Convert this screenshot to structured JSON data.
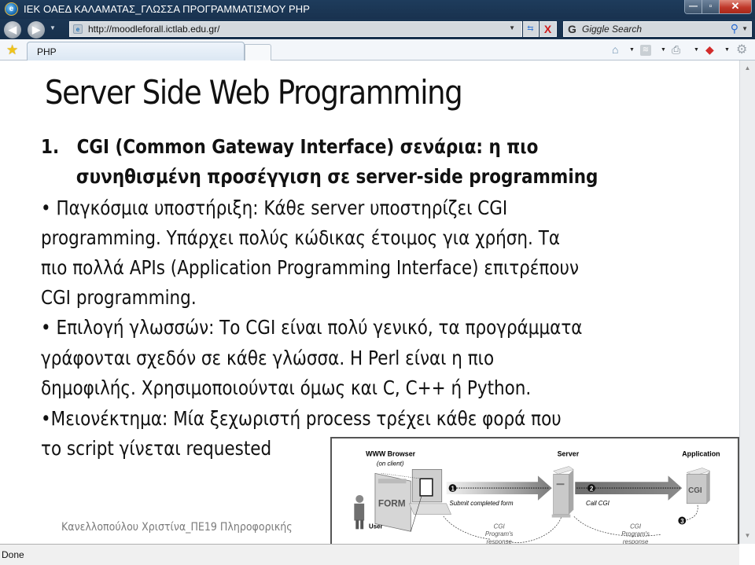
{
  "window": {
    "title": "ΙΕΚ ΟΑΕΔ ΚΑΛΑΜΑΤΑΣ_ΓΛΩΣΣΑ ΠΡΟΓΡΑΜΜΑΤΙΣΜΟΥ PHP",
    "app_icon": "ie-logo-icon",
    "buttons": {
      "minimize": "—",
      "maximize": "▫",
      "close": "✕"
    }
  },
  "nav": {
    "back_icon": "◀",
    "forward_icon": "▶",
    "history_dropdown": "▼",
    "address": "http://moodleforall.ictlab.edu.gr/",
    "address_dropdown": "▼",
    "refresh_icon": "⇆",
    "stop_icon": "X",
    "search_placeholder": "Giggle Search",
    "search_engine_icon": "G",
    "search_icon": "⚲",
    "search_dropdown": "▼"
  },
  "tabs": {
    "favorites_icon": "★",
    "items": [
      {
        "label": "PHP",
        "active": true
      }
    ]
  },
  "command_bar": {
    "home_icon": "⌂",
    "feeds_icon": "≋",
    "print_icon": "⎙",
    "safety_icon": "◆",
    "tools_icon": "⚙",
    "dropdown": "▼"
  },
  "slide": {
    "title": "Server Side Web Programming",
    "lines": [
      {
        "text": "1.   CGI (Common Gateway Interface) σενάρια: η πιο",
        "bold": true
      },
      {
        "text": "      συνηθισμένη προσέγγιση σε server-side programming",
        "bold": true
      },
      {
        "text": "• Παγκόσμια υποστήριξη: Κάθε server υποστηρίζει CGI",
        "bold": false
      },
      {
        "text": "programming. Υπάρχει πολύς κώδικας έτοιμος για χρήση. Τα",
        "bold": false
      },
      {
        "text": "πιο πολλά APIs (Application Programming Interface) επιτρέπουν",
        "bold": false
      },
      {
        "text": "CGI programming.",
        "bold": false
      },
      {
        "text": "• Επιλογή γλωσσών: Το CGI είναι πολύ γενικό, τα προγράμματα",
        "bold": false
      },
      {
        "text": "γράφονται σχεδόν σε κάθε γλώσσα. Η Perl είναι η πιο",
        "bold": false
      },
      {
        "text": "δημοφιλής. Χρησιμοποιούνται όμως και C, C++ ή Python.",
        "bold": false
      },
      {
        "text": "•Μειονέκτημα: Μία ξεχωριστή process τρέχει κάθε φορά που",
        "bold": false
      },
      {
        "text": "το script γίνεται requested",
        "bold": false
      }
    ],
    "footer": "Κανελλοπούλου Χριστίνα_ΠΕ19 Πληροφορικής"
  },
  "diagram": {
    "browser_label": "WWW Browser",
    "browser_sublabel": "(on client)",
    "server_label": "Server",
    "application_label": "Application",
    "form_label": "FORM",
    "user_label": "User",
    "cgi_box_label": "CGI",
    "step1": "1",
    "step1_label": "Submit completed form",
    "step2": "2",
    "step2_label": "Call CGI",
    "step3": "3",
    "response_line1": "CGI",
    "response_line2": "Program's",
    "response_line3": "response"
  },
  "scrollbar": {
    "up": "▲",
    "down": "▼"
  },
  "status": {
    "text": "Done"
  }
}
